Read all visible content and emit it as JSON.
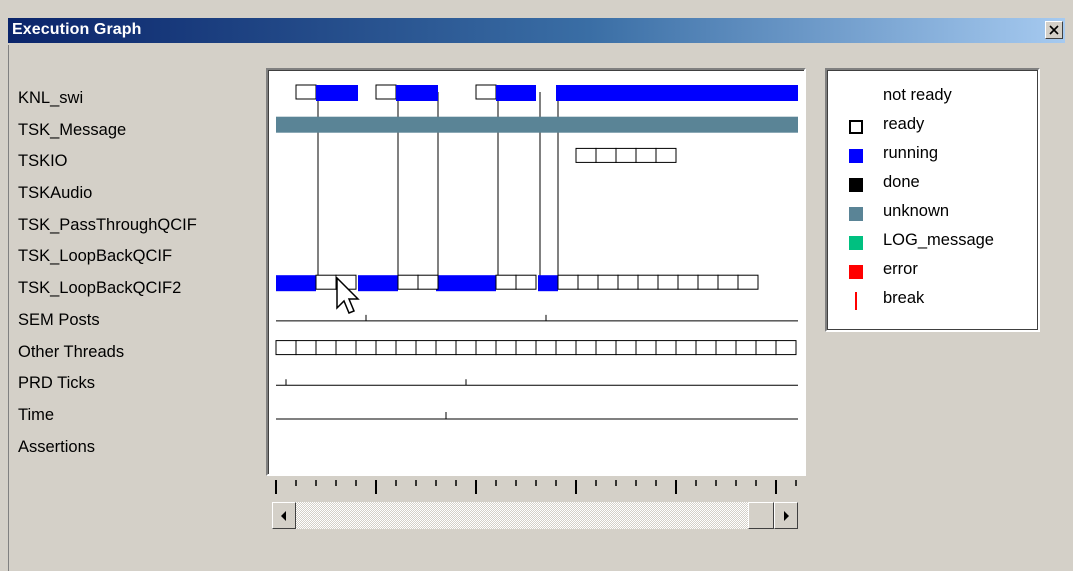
{
  "window": {
    "title": "Execution Graph",
    "close_label": "close"
  },
  "threads": [
    "KNL_swi",
    "TSK_Message",
    "TSKIO",
    "TSKAudio",
    "TSK_PassThroughQCIF",
    "TSK_LoopBackQCIF",
    "TSK_LoopBackQCIF2",
    "SEM Posts",
    "Other Threads",
    "PRD Ticks",
    "Time",
    "Assertions"
  ],
  "legend": [
    {
      "label": "not ready",
      "color": "#ffffff",
      "style": "blank"
    },
    {
      "label": "ready",
      "color": "#ffffff",
      "style": "outlined"
    },
    {
      "label": "running",
      "color": "#0000ff",
      "style": "filled"
    },
    {
      "label": "done",
      "color": "#000000",
      "style": "filled"
    },
    {
      "label": "unknown",
      "color": "#5a8496",
      "style": "filled"
    },
    {
      "label": "LOG_message",
      "color": "#00c080",
      "style": "filled"
    },
    {
      "label": "error",
      "color": "#ff0000",
      "style": "filled"
    },
    {
      "label": "break",
      "color": "#ff0000",
      "style": "line"
    }
  ],
  "colors": {
    "running": "#0000ff",
    "unknown": "#5a8496",
    "titlebar_start": "#0a246a",
    "titlebar_end": "#a6caf0"
  },
  "icons": {
    "close": "close-icon",
    "scroll_left": "left-arrow-icon",
    "scroll_right": "right-arrow-icon",
    "cursor": "mouse-pointer-icon"
  }
}
